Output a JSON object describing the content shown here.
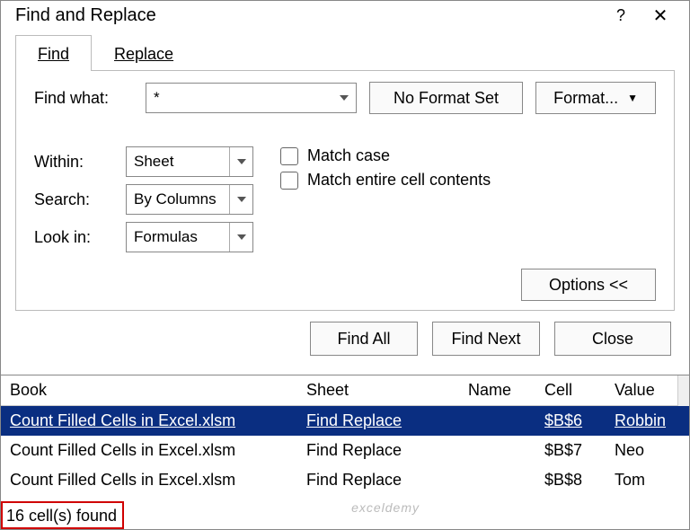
{
  "title": "Find and Replace",
  "tabs": {
    "find": "Find",
    "replace": "Replace"
  },
  "labels": {
    "find_what": "Find what:",
    "within": "Within:",
    "search": "Search:",
    "look_in": "Look in:"
  },
  "inputs": {
    "find_what_value": "*",
    "within_value": "Sheet",
    "search_value": "By Columns",
    "look_in_value": "Formulas"
  },
  "buttons": {
    "no_format": "No Format Set",
    "format": "Format...",
    "options": "Options <<",
    "find_all": "Find All",
    "find_next": "Find Next",
    "close": "Close"
  },
  "checks": {
    "match_case": "Match case",
    "match_entire": "Match entire cell contents"
  },
  "results": {
    "headers": {
      "book": "Book",
      "sheet": "Sheet",
      "name": "Name",
      "cell": "Cell",
      "value": "Value"
    },
    "rows": [
      {
        "book": "Count Filled Cells in Excel.xlsm",
        "sheet": "Find Replace",
        "name": "",
        "cell": "$B$6",
        "value": "Robbin",
        "selected": true
      },
      {
        "book": "Count Filled Cells in Excel.xlsm",
        "sheet": "Find Replace",
        "name": "",
        "cell": "$B$7",
        "value": "Neo",
        "selected": false
      },
      {
        "book": "Count Filled Cells in Excel.xlsm",
        "sheet": "Find Replace",
        "name": "",
        "cell": "$B$8",
        "value": "Tom",
        "selected": false
      }
    ],
    "status": "16 cell(s) found"
  },
  "watermark": "exceldemy"
}
